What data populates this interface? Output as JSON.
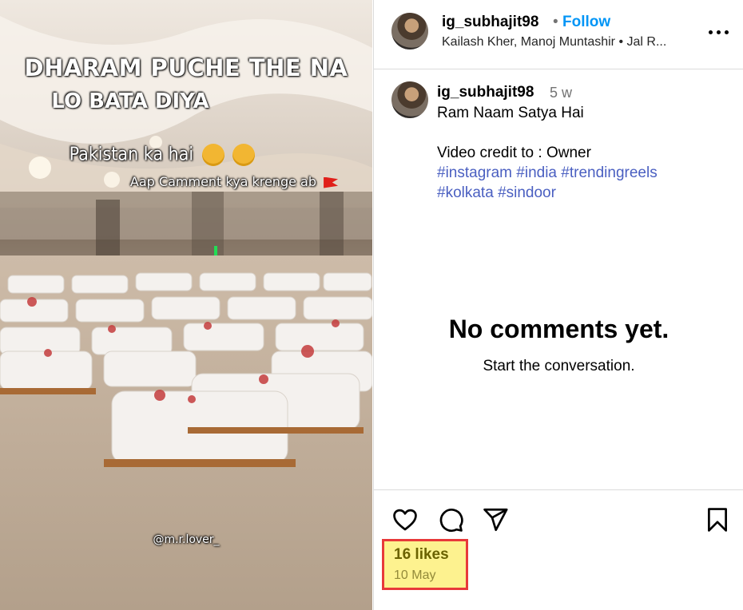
{
  "media": {
    "overlay_line1": "DHARAM PUCHE THE NA",
    "overlay_line2": "LO BATA DIYA",
    "overlay_line3": "Pakistan ka hai",
    "overlay_line4": "Aap Camment kya krenge ab",
    "watermark": "@m.r.lover_"
  },
  "header": {
    "username": "ig_subhajit98",
    "separator": "•",
    "follow_label": "Follow",
    "audio": "Kailash Kher, Manoj Muntashir • Jal R..."
  },
  "caption": {
    "username": "ig_subhajit98",
    "time": "5 w",
    "line1": "Ram Naam Satya Hai",
    "line2": "Video credit to : Owner",
    "hashtags_line1": [
      "#instagram",
      "#india",
      "#trendingreels"
    ],
    "hashtags_line2": [
      "#kolkata",
      "#sindoor"
    ]
  },
  "comments": {
    "empty_title": "No comments yet.",
    "empty_subtitle": "Start the conversation."
  },
  "footer": {
    "likes": "16 likes",
    "date": "10 May"
  },
  "icons": {
    "like": "heart-icon",
    "comment": "comment-icon",
    "share": "paper-plane-icon",
    "save": "bookmark-icon",
    "more": "more-options-icon"
  },
  "colors": {
    "follow": "#0095f6",
    "hashtag": "#4a5fc1",
    "highlight_fill": "#fdf28f",
    "highlight_border": "#e8393a"
  }
}
